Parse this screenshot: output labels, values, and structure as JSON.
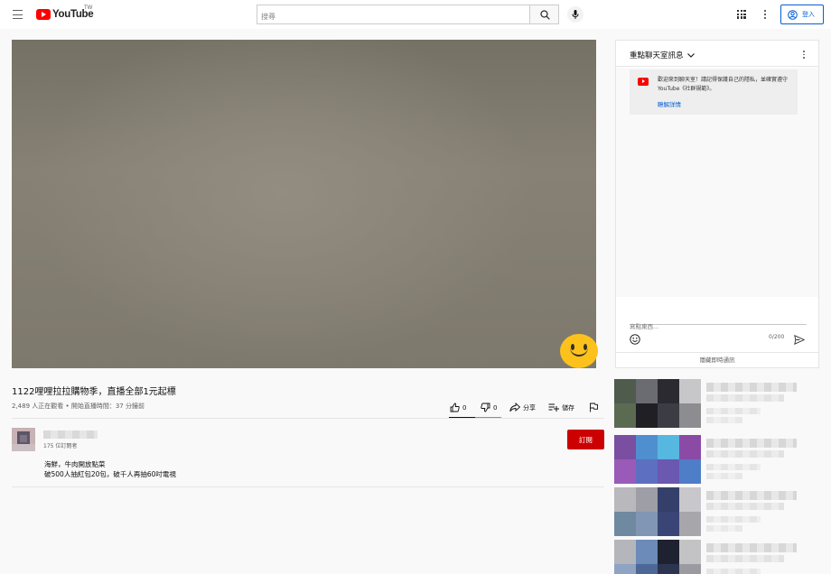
{
  "header": {
    "logo_text": "YouTube",
    "region": "TW",
    "search_placeholder": "搜尋",
    "signin_label": "登入"
  },
  "video": {
    "title": "1122哩哩拉拉購物季，直播全部1元起標",
    "meta": "2,489 人正在觀看 • 開始直播時間：37 分鐘前",
    "like_count": "0",
    "dislike_count": "0",
    "share_label": "分享",
    "save_label": "儲存",
    "like_ratio": 0.5
  },
  "channel": {
    "subscribers": "175 位訂閱者",
    "subscribe_label": "訂閱",
    "description": [
      "海鮮，牛肉開放點菜",
      "破500人抽紅包20包，破千人再抽60吋電視"
    ]
  },
  "chat": {
    "mode_label": "重點聊天室訊息",
    "welcome_text": "歡迎來到聊天室！請記得保護自己的隱私，並確實遵守 YouTube《社群規範》。",
    "learn_more": "瞭解詳情",
    "input_placeholder": "寫點東西...",
    "char_count": "0/200",
    "hide_chat": "隱藏即時通訊"
  },
  "colors": {
    "brand_red": "#ff0000",
    "subscribe_red": "#cc0000",
    "link_blue": "#065fd4"
  },
  "icons": [
    "menu-icon",
    "youtube-logo-icon",
    "search-icon",
    "mic-icon",
    "apps-icon",
    "more-vert-icon",
    "account-icon",
    "thumb-up-icon",
    "thumb-down-icon",
    "share-icon",
    "playlist-add-icon",
    "flag-icon",
    "chevron-down-icon",
    "emoji-icon",
    "send-icon"
  ]
}
